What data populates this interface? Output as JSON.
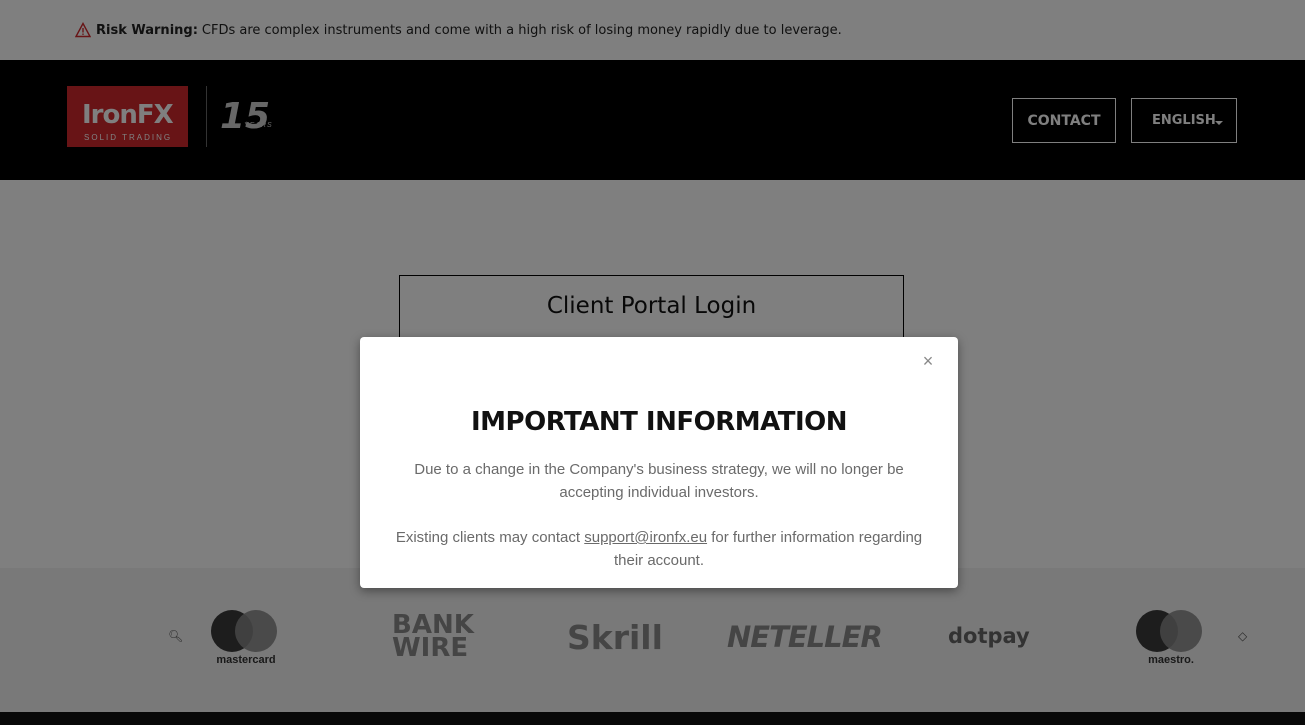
{
  "risk_warning": {
    "label": "Risk Warning:",
    "text": "CFDs are complex instruments and come with a high risk of losing money rapidly due to leverage.",
    "icon": "warning-triangle-icon"
  },
  "header": {
    "logo_text": "IronFX",
    "logo_tagline": "SOLID TRADING",
    "years_number": "15",
    "years_label": "YEARS",
    "contact_label": "CONTACT",
    "language_label": "ENGLISH"
  },
  "main": {
    "login_title": "Client Portal Login"
  },
  "payments": {
    "logos": [
      "mastercard",
      "BANK",
      "WIRE",
      "Skrill",
      "NETELLER",
      "dotpay",
      "maestro."
    ]
  },
  "modal": {
    "close_glyph": "×",
    "title": "IMPORTANT INFORMATION",
    "paragraph1": "Due to a change in the Company's business strategy, we will no longer be accepting individual investors.",
    "paragraph2_before": "Existing clients may contact ",
    "paragraph2_link": "support@ironfx.eu",
    "paragraph2_after": " for further information regarding their account."
  },
  "colors": {
    "brand_red": "#d0282d",
    "header_bg": "#000000",
    "overlay": "rgba(0,0,0,0.5)"
  }
}
